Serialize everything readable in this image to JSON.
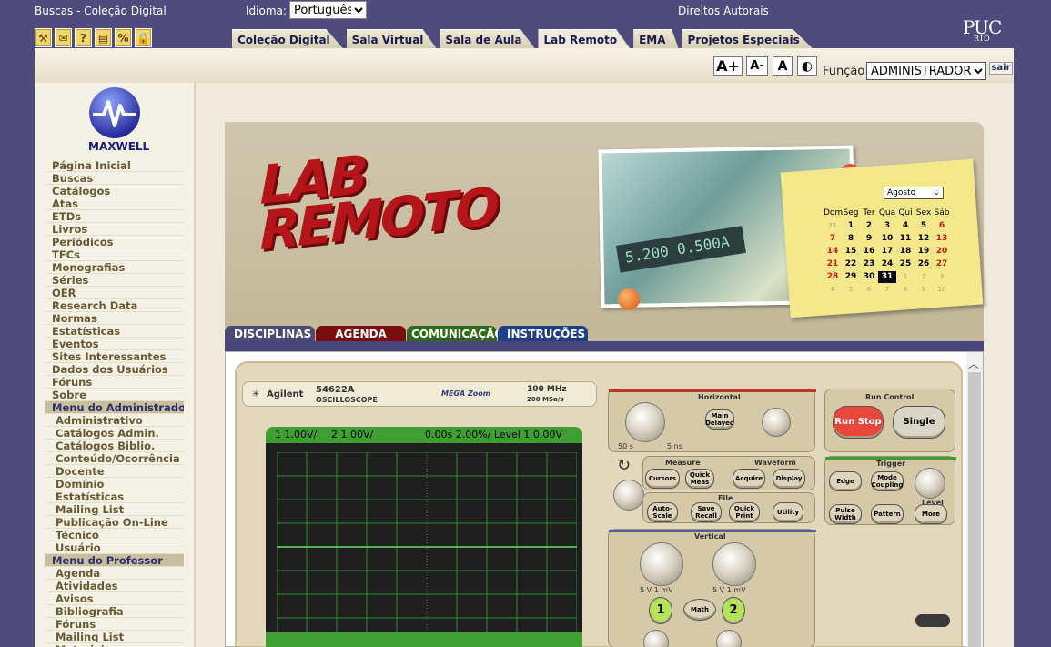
{
  "topbar": {
    "buscas_label": "Buscas - Coleção Digital",
    "idioma_label": "Idioma:",
    "idioma_value": "Português",
    "direitos_label": "Direitos Autorais",
    "puc_logo": "PUC",
    "puc_logo_sub": "RIO"
  },
  "icons": [
    "tools-icon",
    "mail-icon",
    "help-icon",
    "presentation-icon",
    "percent-icon",
    "lock-icon"
  ],
  "tabs": [
    {
      "label": "Coleção Digital"
    },
    {
      "label": "Sala Virtual"
    },
    {
      "label": "Sala de Aula"
    },
    {
      "label": "Lab Remoto"
    },
    {
      "label": "EMA"
    },
    {
      "label": "Projetos Especiais"
    }
  ],
  "toolbar": {
    "font_increase": "A+",
    "font_decrease": "A-",
    "font_reset": "A",
    "funcao_label": "Função:",
    "funcao_value": "ADMINISTRADOR",
    "sair_label": "sair"
  },
  "sidebar": {
    "logo_text": "MAXWELL",
    "items": [
      "Página Inicial",
      "Buscas",
      "Catálogos",
      "Atas",
      "ETDs",
      "Livros",
      "Periódicos",
      "TFCs",
      "Monografias",
      "Séries",
      "OER",
      "Research Data",
      "Normas",
      "Estatísticas",
      "Eventos",
      "Sites Interessantes",
      "Dados dos Usuários",
      "Fóruns",
      "Sobre"
    ],
    "admin_header": "Menu do Administrador",
    "admin_items": [
      "Administrativo",
      "Catálogos Admin.",
      "Catálogos Biblio.",
      "Conteúdo/Ocorrência",
      "Docente",
      "Domínio",
      "Estatísticas",
      "Mailing List",
      "Publicação On-Line",
      "Técnico",
      "Usuário"
    ],
    "prof_header": "Menu do Professor",
    "prof_items": [
      "Agenda",
      "Atividades",
      "Avisos",
      "Bibliografia",
      "Fóruns",
      "Mailing List",
      "Materiais"
    ]
  },
  "banner": {
    "title_line1": "LAB",
    "title_line2": "REMOTO",
    "lcd_text": "5.200  0.500A",
    "calendar": {
      "month": "Agosto",
      "headers": [
        "Dom",
        "Seg",
        "Ter",
        "Qua",
        "Qui",
        "Sex",
        "Sáb"
      ],
      "weeks": [
        [
          "31",
          "1",
          "2",
          "3",
          "4",
          "5",
          "6"
        ],
        [
          "7",
          "8",
          "9",
          "10",
          "11",
          "12",
          "13"
        ],
        [
          "14",
          "15",
          "16",
          "17",
          "18",
          "19",
          "20"
        ],
        [
          "21",
          "22",
          "23",
          "24",
          "25",
          "26",
          "27"
        ],
        [
          "28",
          "29",
          "30",
          "31",
          "1",
          "2",
          "3"
        ],
        [
          "4",
          "5",
          "6",
          "7",
          "8",
          "9",
          "10"
        ]
      ],
      "selected": "31"
    },
    "tabs": [
      {
        "label": "DISCIPLINAS",
        "color": "#4a4a74"
      },
      {
        "label": "AGENDA",
        "color": "#7a0d0d"
      },
      {
        "label": "COMUNICAÇÃO",
        "color": "#2d6a1b"
      },
      {
        "label": "INSTRUÇÕES",
        "color": "#1d3f86"
      }
    ]
  },
  "oscilloscope": {
    "brand": "Agilent",
    "model": "54622A",
    "model_sub": "OSCILLOSCOPE",
    "megazoom": "MEGA Zoom",
    "bandwidth": "100 MHz",
    "sample_rate": "200 MSa/s",
    "screen": {
      "ch1": "1  1.00V/",
      "ch2": "2  1.00V/",
      "time": "0.00s  2.00%/  Level  1  0.00V"
    },
    "sections": {
      "horizontal": "Horizontal",
      "run_control": "Run Control",
      "measure": "Measure",
      "waveform": "Waveform",
      "trigger": "Trigger",
      "file": "File",
      "vertical": "Vertical",
      "level": "Level"
    },
    "buttons": {
      "main_delayed": "Main Delayed",
      "run_stop": "Run Stop",
      "single": "Single",
      "cursors": "Cursors",
      "quick_meas": "Quick Meas",
      "acquire": "Acquire",
      "display": "Display",
      "edge": "Edge",
      "mode_coupling": "Mode Coupling",
      "auto_scale": "Auto-Scale",
      "save_recall": "Save Recall",
      "quick_print": "Quick Print",
      "utility": "Utility",
      "pulse_width": "Pulse Width",
      "pattern": "Pattern",
      "more": "More",
      "math": "Math",
      "ch1": "1",
      "ch2": "2"
    },
    "knob_labels": {
      "hz_left": "50 s",
      "hz_right": "5 ns",
      "v1": "5 V       1 mV",
      "v2": "5 V       1 mV"
    }
  }
}
